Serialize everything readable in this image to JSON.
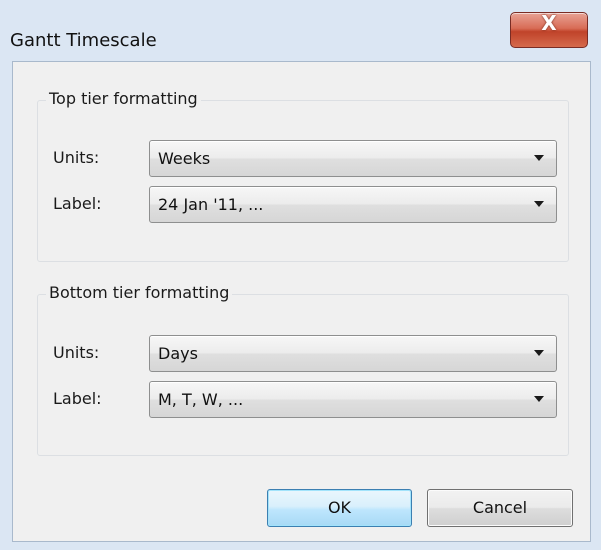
{
  "window": {
    "title": "Gantt Timescale",
    "close_glyph": "X"
  },
  "top_tier": {
    "legend": "Top tier formatting",
    "units_label": "Units:",
    "units_value": "Weeks",
    "label_label": "Label:",
    "label_value": "24 Jan '11, ..."
  },
  "bottom_tier": {
    "legend": "Bottom tier formatting",
    "units_label": "Units:",
    "units_value": "Days",
    "label_label": "Label:",
    "label_value": "M, T, W, ..."
  },
  "buttons": {
    "ok": "OK",
    "cancel": "Cancel"
  },
  "colors": {
    "window_frame": "#dbe6f3",
    "client_bg": "#f0f0f0",
    "close_button": "#c0432a",
    "ok_border": "#3c7fb1"
  },
  "icons": {
    "close": "close-icon",
    "dropdown": "chevron-down-icon"
  }
}
